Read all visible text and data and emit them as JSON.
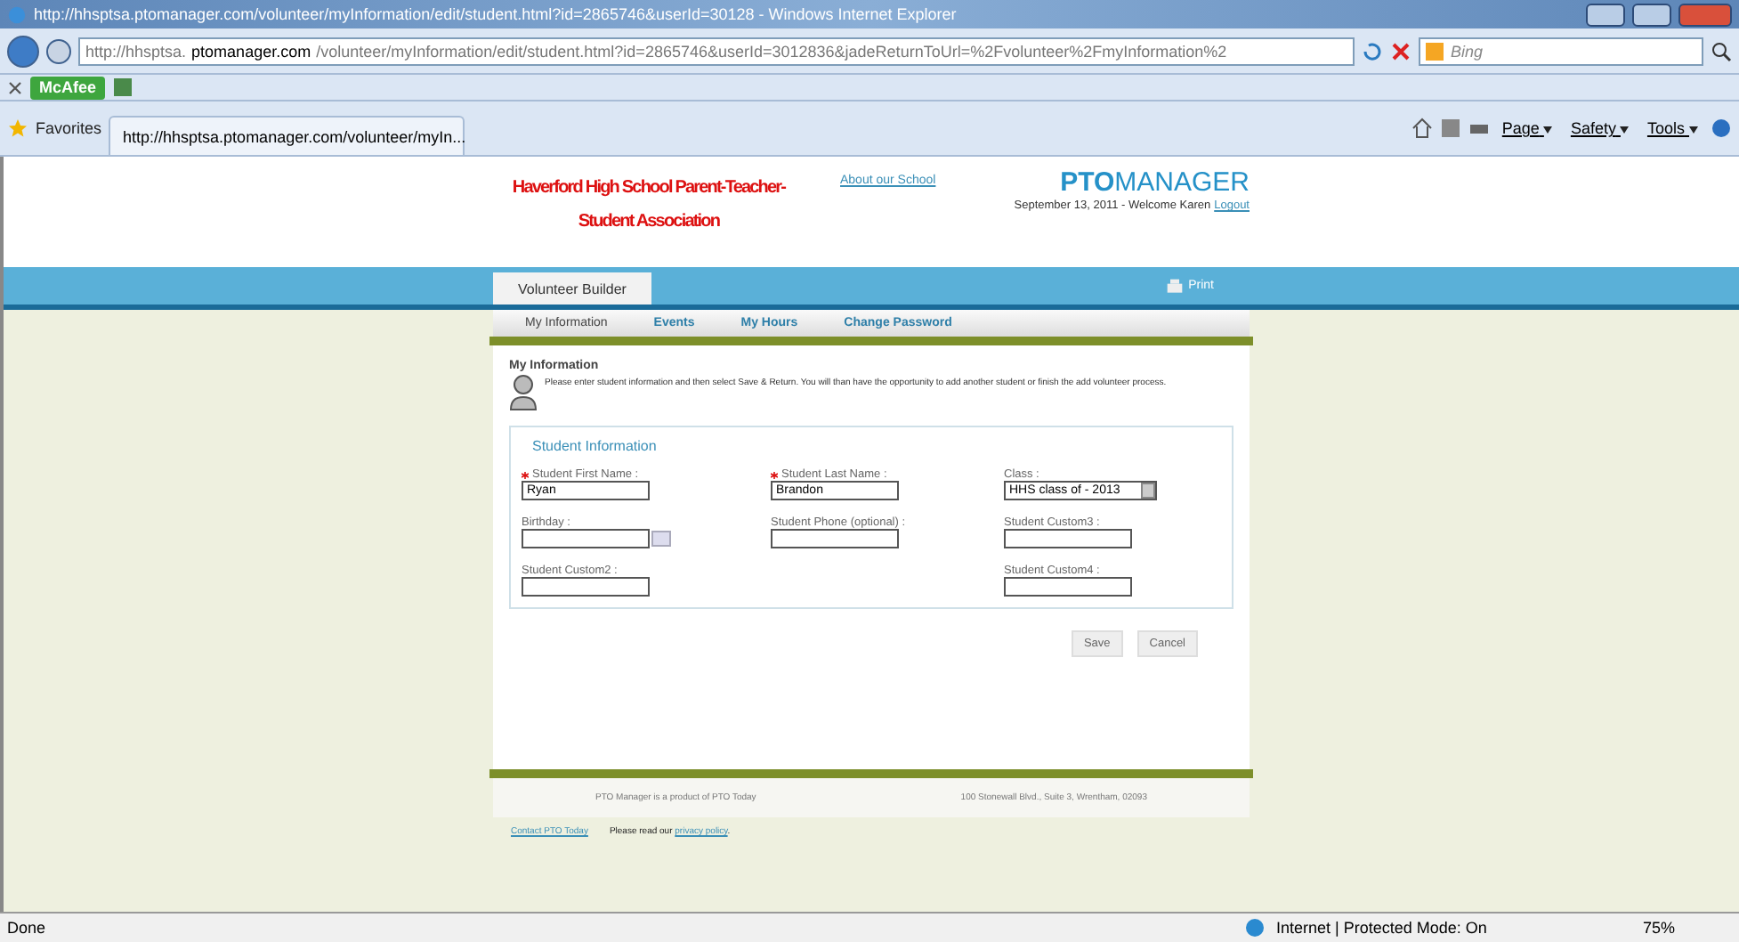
{
  "browser": {
    "title": "http://hhsptsa.ptomanager.com/volunteer/myInformation/edit/student.html?id=2865746&userId=30128 - Windows Internet Explorer",
    "address": {
      "prefix": "http://hhsptsa.",
      "domain": "ptomanager.com",
      "rest": "/volunteer/myInformation/edit/student.html?id=2865746&userId=3012836&jadeReturnToUrl=%2Fvolunteer%2FmyInformation%2"
    },
    "search_placeholder": "Bing",
    "addon": "McAfee",
    "favorites": "Favorites",
    "tab_title": "http://hhsptsa.ptomanager.com/volunteer/myIn...",
    "commands": [
      "Page",
      "Safety",
      "Tools"
    ],
    "status": "Done",
    "zone": "Internet | Protected Mode: On",
    "zoom": "75%"
  },
  "page": {
    "school_name": "Haverford High School Parent-Teacher-Student Association",
    "about_link": "About our School",
    "brand": {
      "bold": "PTO",
      "rest": "MANAGER"
    },
    "welcome": "September 13, 2011 - Welcome Karen",
    "logout": "Logout",
    "main_tab": "Volunteer Builder",
    "print": "Print",
    "nav": [
      {
        "label": "My Information",
        "selected": true
      },
      {
        "label": "Events",
        "selected": false
      },
      {
        "label": "My Hours",
        "selected": false
      },
      {
        "label": "Change Password",
        "selected": false
      }
    ],
    "section_title": "My Information",
    "instructions": "Please enter student information and then select Save & Return. You will than have the opportunity to add another student or finish the add volunteer process.",
    "fieldset_title": "Student Information",
    "rows": [
      [
        {
          "kind": "text",
          "label": "Student First Name :",
          "required": true,
          "value": "Ryan"
        },
        {
          "kind": "text",
          "label": "Student Last Name :",
          "required": true,
          "value": "Brandon"
        },
        {
          "kind": "select",
          "label": "Class :",
          "required": false,
          "value": "HHS class of - 2013"
        }
      ],
      [
        {
          "kind": "date",
          "label": "Birthday :",
          "required": false
        },
        {
          "kind": "text",
          "label": "Student Phone (optional) :",
          "required": false
        },
        {
          "kind": "text",
          "label": "Student Custom3 :",
          "required": false
        }
      ],
      [
        {
          "kind": "text",
          "label": "Student Custom2 :",
          "required": false
        },
        {
          "kind": "spacer"
        },
        {
          "kind": "text",
          "label": "Student Custom4 :",
          "required": false
        }
      ]
    ],
    "buttons": [
      "Save",
      "Cancel"
    ],
    "footer": {
      "product": "PTO Manager is a product of PTO Today",
      "address": "100 Stonewall Blvd., Suite 3, Wrentham, 02093",
      "contact_link": "Contact PTO Today",
      "privacy_text": "Please read our ",
      "privacy_link": "privacy policy",
      "privacy_end": "."
    }
  }
}
